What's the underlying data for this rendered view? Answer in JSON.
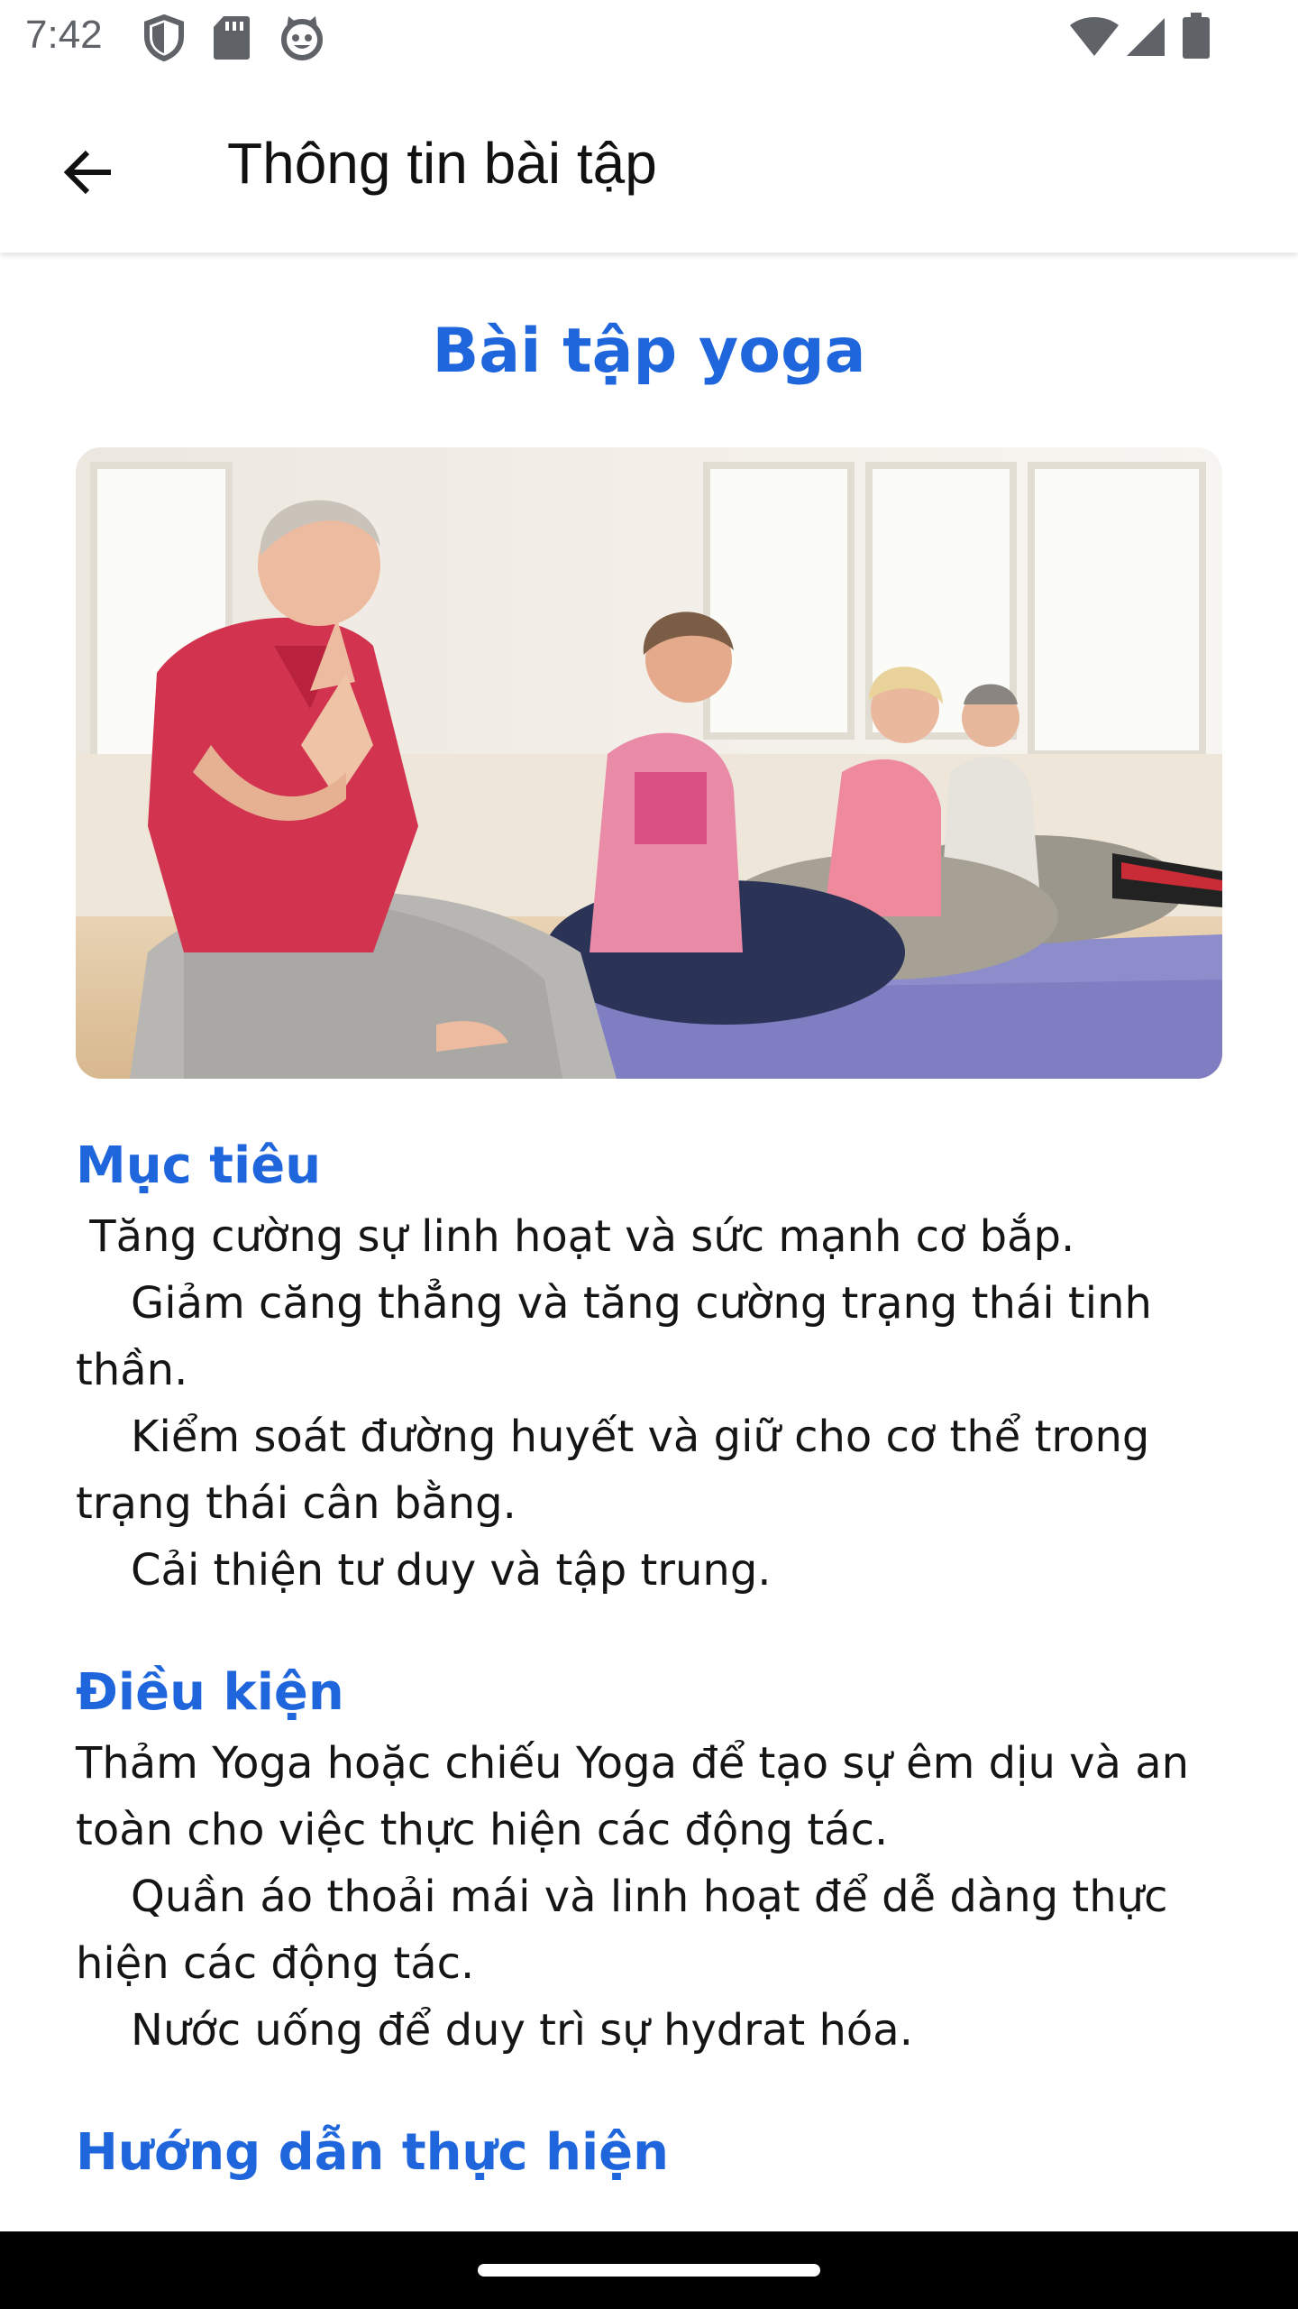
{
  "status_bar": {
    "time": "7:42",
    "left_icons": [
      "shield-icon",
      "sd-card-icon",
      "cat-face-icon"
    ],
    "right_icons": [
      "wifi-icon",
      "signal-icon",
      "battery-icon"
    ]
  },
  "app_bar": {
    "back_icon": "arrow-left-icon",
    "title": "Thông tin bài tập"
  },
  "exercise": {
    "title": "Bài tập yoga",
    "image": "senior-yoga-class-photo"
  },
  "sections": {
    "goals": {
      "heading": "Mục tiêu",
      "lines": [
        " Tăng cường sự linh hoạt và sức mạnh cơ bắp.",
        "    Giảm căng thẳng và tăng cường trạng thái tinh thần.",
        "    Kiểm soát đường huyết và giữ cho cơ thể trong trạng thái cân bằng.",
        "    Cải thiện tư duy và tập trung."
      ]
    },
    "conditions": {
      "heading": "Điều kiện",
      "lines": [
        "Thảm Yoga hoặc chiếu Yoga để tạo sự êm dịu và an toàn cho việc thực hiện các động tác.",
        "    Quần áo thoải mái và linh hoạt để dễ dàng thực hiện các động tác.",
        "    Nước uống để duy trì sự hydrat hóa."
      ]
    },
    "instructions": {
      "heading": "Hướng dẫn thực hiện"
    }
  },
  "colors": {
    "accent": "#1f66dc",
    "text": "#151515",
    "status_icon": "#5f6368"
  }
}
